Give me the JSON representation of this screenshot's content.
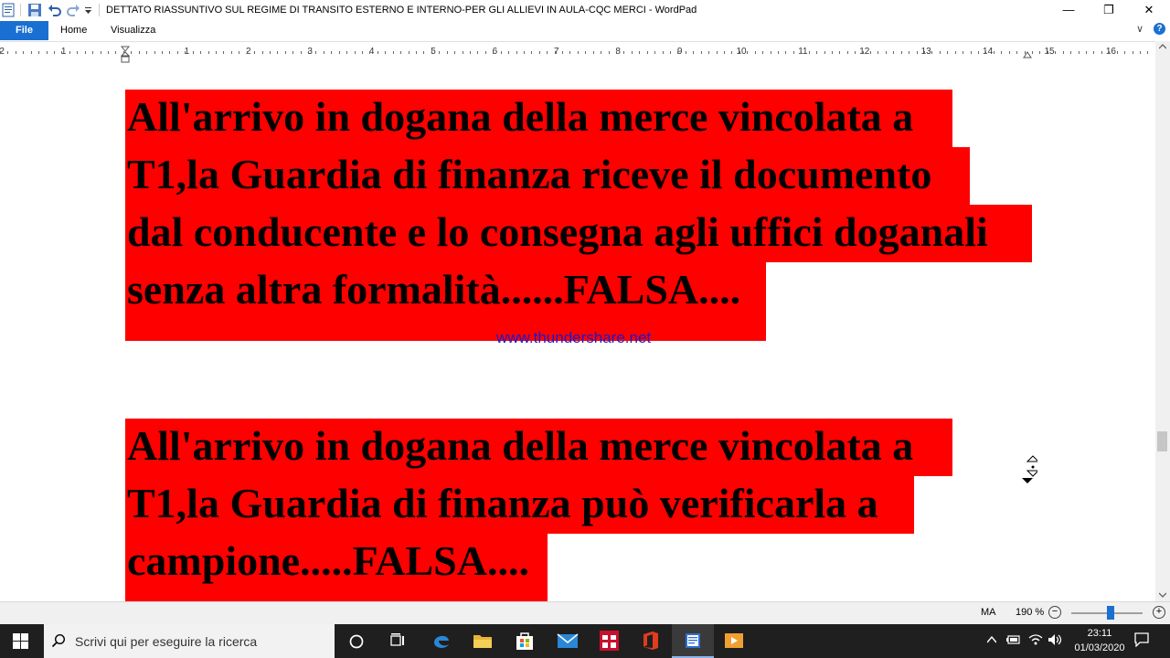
{
  "window": {
    "title": "DETTATO RIASSUNTIVO SUL REGIME DI TRANSITO ESTERNO E INTERNO-PER GLI ALLIEVI IN AULA-CQC MERCI - WordPad",
    "minimize": "—",
    "restore": "❐",
    "close": "✕"
  },
  "ribbon": {
    "file": "File",
    "home": "Home",
    "view": "Visualizza",
    "collapse": "∨",
    "help": "?"
  },
  "ruler": {
    "labels": [
      "2",
      "1",
      "1",
      "2",
      "3",
      "4",
      "5",
      "6",
      "7",
      "8",
      "9",
      "10",
      "11",
      "12",
      "13",
      "14",
      "15",
      "16"
    ]
  },
  "document": {
    "paragraph1": [
      "All'arrivo in dogana della merce vincolata a",
      "T1,la Guardia di finanza riceve il documento",
      "dal conducente e lo consegna agli uffici doganali",
      "senza altra formalità......FALSA...."
    ],
    "paragraph2": [
      "All'arrivo in dogana della merce vincolata a",
      "T1,la Guardia di finanza può verificarla a",
      "campione.....FALSA...."
    ],
    "watermark": "www.thundershare.net",
    "highlight_color": "#ff0000"
  },
  "statusbar": {
    "caps": "MA",
    "zoom": "190 %",
    "zoom_out": "−",
    "zoom_in": "+",
    "zoom_level": 0.55
  },
  "taskbar": {
    "search_placeholder": "Scrivi qui per eseguire la ricerca",
    "time": "23:11",
    "date": "01/03/2020"
  }
}
